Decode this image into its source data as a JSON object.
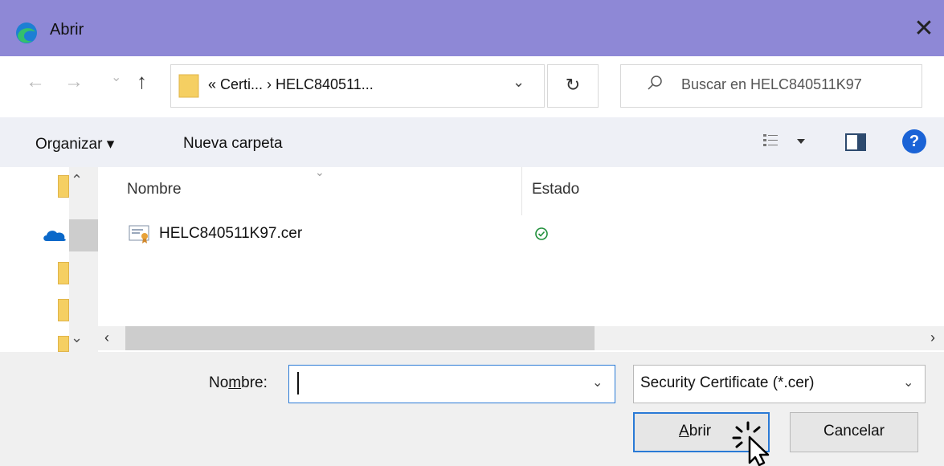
{
  "window": {
    "title": "Abrir",
    "close_glyph": "✕",
    "icon": "edge-browser-icon"
  },
  "navigation": {
    "back_glyph": "←",
    "forward_glyph": "→",
    "recent_glyph": "⌄",
    "up_glyph": "↑",
    "address_text": "« Certi...  ›  HELC840511...",
    "address_dropdown_glyph": "⌄",
    "refresh_glyph": "↻",
    "search_placeholder": "Buscar en HELC840511K97"
  },
  "toolbar": {
    "organize_label": "Organizar ▾",
    "new_folder_label": "Nueva carpeta",
    "help_glyph": "?"
  },
  "file_list": {
    "columns": [
      "Nombre",
      "Estado"
    ],
    "sort_glyph": "⌄",
    "rows": [
      {
        "name": "HELC840511K97.cer",
        "status": "synced",
        "icon": "certificate-file-icon"
      }
    ]
  },
  "left_pane": {
    "scroll_up_glyph": "⌃",
    "scroll_down_glyph": "⌄",
    "items": [
      "folder-icon",
      "onedrive-cloud-icon",
      "folder-icon",
      "folder-icon",
      "folder-icon"
    ]
  },
  "hscroll": {
    "left_glyph": "‹",
    "right_glyph": "›"
  },
  "bottom": {
    "name_label_pre": "No",
    "name_label_u": "m",
    "name_label_post": "bre:",
    "name_value": "",
    "name_dropdown_glyph": "⌄",
    "file_type": "Security Certificate (*.cer)",
    "file_type_dropdown_glyph": "⌄",
    "open_label_u": "A",
    "open_label_post": "brir",
    "cancel_label": "Cancelar"
  },
  "colors": {
    "titlebar": "#8e88d6",
    "toolbar": "#eef0f6",
    "accent": "#2a7ad6",
    "folder": "#f5cf62",
    "status_ok": "#1f8f3a"
  }
}
